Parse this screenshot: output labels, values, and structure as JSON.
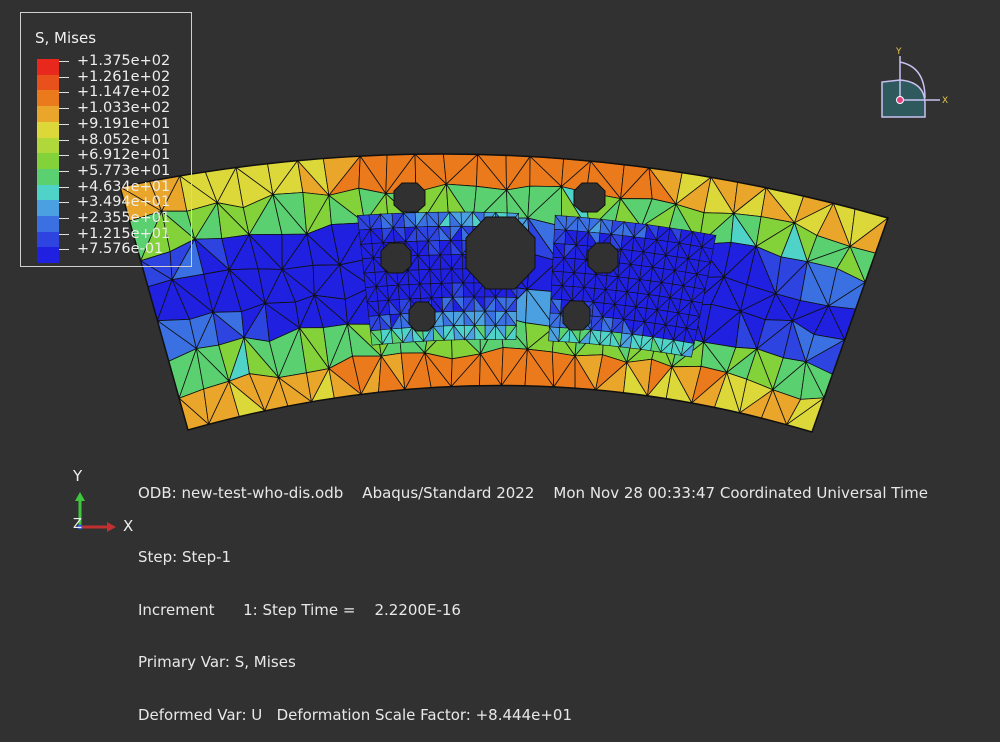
{
  "legend": {
    "title": "S, Mises",
    "entries": [
      {
        "label": "+1.375e+02",
        "color": "#e8281c"
      },
      {
        "label": "+1.261e+02",
        "color": "#e8501c"
      },
      {
        "label": "+1.147e+02",
        "color": "#ea7a1c"
      },
      {
        "label": "+1.033e+02",
        "color": "#e9a62a"
      },
      {
        "label": "+9.191e+01",
        "color": "#dcd83a"
      },
      {
        "label": "+8.052e+01",
        "color": "#b0d83a"
      },
      {
        "label": "+6.912e+01",
        "color": "#84d23a"
      },
      {
        "label": "+5.773e+01",
        "color": "#5ad070"
      },
      {
        "label": "+4.634e+01",
        "color": "#4fd2c8"
      },
      {
        "label": "+3.494e+01",
        "color": "#4aa0e0"
      },
      {
        "label": "+2.355e+01",
        "color": "#3a70e2"
      },
      {
        "label": "+1.215e+01",
        "color": "#2d44e0"
      },
      {
        "label": "+7.576e-01",
        "color": "#2020e0"
      }
    ]
  },
  "footer": {
    "odb": "ODB: new-test-who-dis.odb    Abaqus/Standard 2022    Mon Nov 28 00:33:47 Coordinated Universal Time",
    "step": "Step: Step-1",
    "increment": "Increment      1: Step Time =    2.2200E-16",
    "primary_var": "Primary Var: S, Mises",
    "deformed_var": "Deformed Var: U   Deformation Scale Factor: +8.444e+01"
  },
  "triad": {
    "x_label": "X",
    "y_label": "Y",
    "z_label": "Z"
  },
  "compass": {
    "x_label": "X",
    "y_label": "Y"
  },
  "colors": {
    "background": "#313131",
    "mesh_edge": "#101010"
  }
}
